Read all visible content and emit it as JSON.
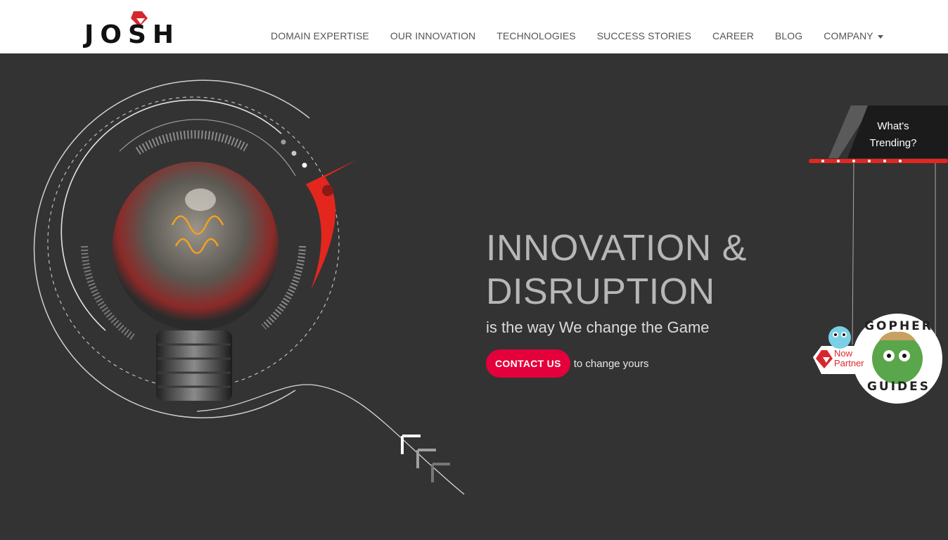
{
  "brand": {
    "logo_text": "JOSH",
    "accent": "#e4003b"
  },
  "nav": {
    "items": [
      {
        "label": "DOMAIN EXPERTISE"
      },
      {
        "label": "OUR INNOVATION"
      },
      {
        "label": "TECHNOLOGIES"
      },
      {
        "label": "SUCCESS STORIES"
      },
      {
        "label": "CAREER"
      },
      {
        "label": "BLOG"
      },
      {
        "label": "COMPANY",
        "has_dropdown": true
      }
    ]
  },
  "hero": {
    "headline_line1": "INNOVATION &",
    "headline_line2": "DISRUPTION",
    "subheadline": "is the way We change the Game",
    "cta_button": "CONTACT US",
    "cta_suffix": "to change yours",
    "background": "#333333"
  },
  "trending": {
    "line1": "What's",
    "line2": "Trending?"
  },
  "partner": {
    "line1": "Now",
    "line2": "Partner",
    "badge_top": "GOPHER",
    "badge_bottom": "GUIDES"
  }
}
